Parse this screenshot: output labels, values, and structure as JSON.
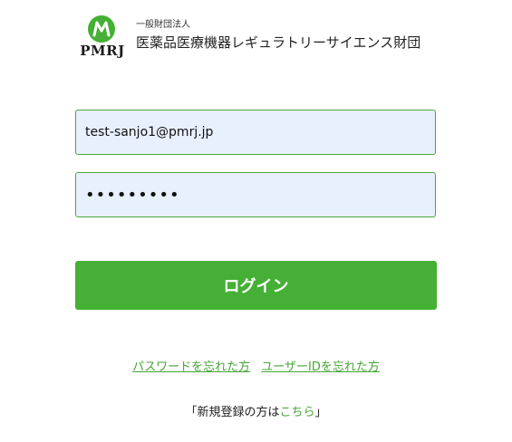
{
  "header": {
    "logo_text": "PMRJ",
    "org_type": "一般財団法人",
    "org_name": "医薬品医療機器レギュラトリーサイエンス財団",
    "brand_color": "#45b035"
  },
  "login_form": {
    "email_value": "test-sanjo1@pmrj.jp",
    "password_value": "•••••••••",
    "login_label": "ログイン"
  },
  "links": {
    "forgot_password": "パスワードを忘れた方",
    "forgot_user_id": "ユーザーIDを忘れた方"
  },
  "register": {
    "prefix": "「新規登録の方は",
    "link": "こちら",
    "suffix": "」"
  }
}
